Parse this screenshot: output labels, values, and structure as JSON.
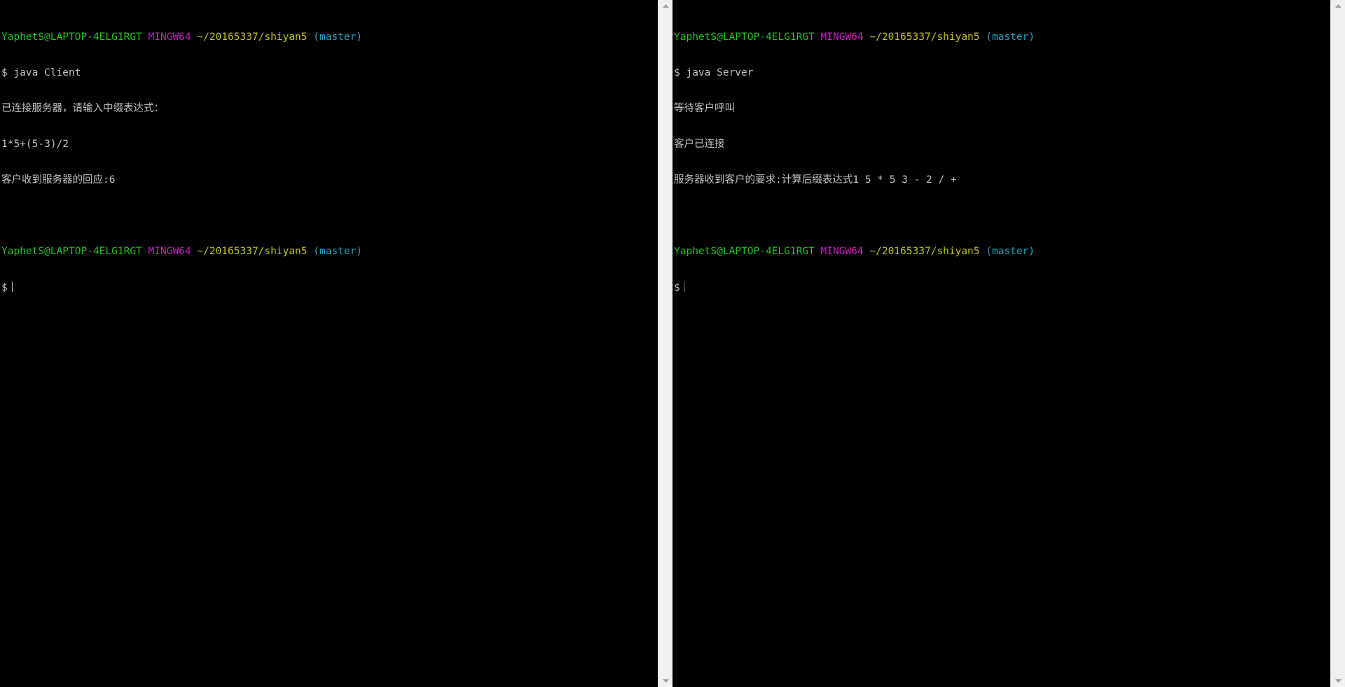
{
  "left_terminal": {
    "prompt1": {
      "user": "YaphetS@LAPTOP-4ELG1RGT",
      "system": "MINGW64",
      "path": "~/20165337/shiyan5",
      "branch": "(master)"
    },
    "command": "$ java Client",
    "output": [
      "已连接服务器，请输入中缀表达式：",
      "1*5+(5-3)/2",
      "客户收到服务器的回应:6"
    ],
    "prompt2": {
      "user": "YaphetS@LAPTOP-4ELG1RGT",
      "system": "MINGW64",
      "path": "~/20165337/shiyan5",
      "branch": "(master)"
    },
    "input_prefix": "$"
  },
  "right_terminal": {
    "prompt1": {
      "user": "YaphetS@LAPTOP-4ELG1RGT",
      "system": "MINGW64",
      "path": "~/20165337/shiyan5",
      "branch": "(master)"
    },
    "command": "$ java Server",
    "output": [
      "等待客户呼叫",
      "客户已连接",
      "服务器收到客户的要求:计算后缀表达式1 5 * 5 3 - 2 / +"
    ],
    "prompt2": {
      "user": "YaphetS@LAPTOP-4ELG1RGT",
      "system": "MINGW64",
      "path": "~/20165337/shiyan5",
      "branch": "(master)"
    },
    "input_prefix": "$"
  },
  "colors": {
    "background": "#000000",
    "user": "#1fc31f",
    "system": "#c41fc4",
    "path": "#c2c21f",
    "branch": "#1fa6c2",
    "text": "#c0c0c0"
  },
  "icons": [
    "scroll-up-arrow-icon",
    "scroll-down-arrow-icon"
  ]
}
